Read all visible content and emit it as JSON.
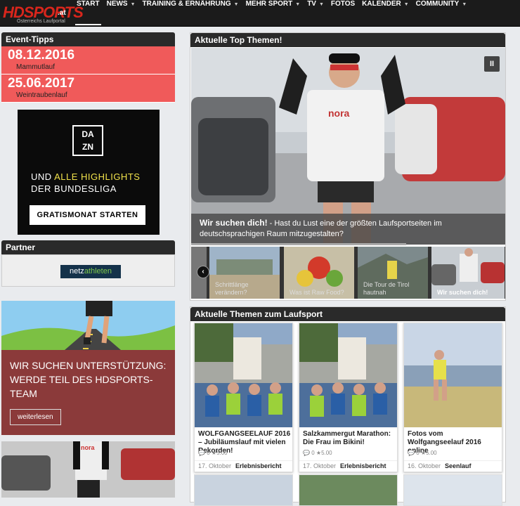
{
  "logo": {
    "text": "HDSPORTS",
    "suffix": ".at",
    "tagline": "Österreichs Laufportal"
  },
  "nav": {
    "items": [
      {
        "label": "START",
        "dropdown": false
      },
      {
        "label": "NEWS",
        "dropdown": true
      },
      {
        "label": "TRAINING & ERNÄHRUNG",
        "dropdown": true
      },
      {
        "label": "MEHR SPORT",
        "dropdown": true
      },
      {
        "label": "TV",
        "dropdown": true
      },
      {
        "label": "FOTOS",
        "dropdown": false
      },
      {
        "label": "KALENDER",
        "dropdown": true
      },
      {
        "label": "COMMUNITY",
        "dropdown": true
      }
    ]
  },
  "event_tipps": {
    "title": "Event-Tipps",
    "events": [
      {
        "date": "08.12.2016",
        "name": "Mammutlauf"
      },
      {
        "date": "25.06.2017",
        "name": "Weintraubenlauf"
      }
    ]
  },
  "ad": {
    "brand_top": "DA",
    "brand_bottom": "ZN",
    "line1_prefix": "UND ",
    "line1_highlight": "ALLE HIGHLIGHTS",
    "line2": "DER BUNDESLIGA",
    "button": "GRATISMONAT STARTEN"
  },
  "partner": {
    "title": "Partner",
    "logo_a": "netz",
    "logo_b": "athleten"
  },
  "support": {
    "title": "WIR SUCHEN UNTERSTÜTZUNG: WERDE TEIL DES HDSPORTS-TEAM",
    "button": "weiterlesen"
  },
  "top_themen": {
    "title": "Aktuelle Top Themen!",
    "pause_icon": "II",
    "caption_title": "Wir suchen dich!",
    "caption_text": " - Hast du Lust eine der größten Laufsportseiten im deutschsprachigen Raum mitzugestalten?",
    "slide_shirt": "nora",
    "thumbnails": [
      {
        "label": "Schrittlänge verändern?"
      },
      {
        "label": "Was ist Raw Food?"
      },
      {
        "label": "Die Tour de Tirol hautnah"
      },
      {
        "label": "Wir suchen dich!"
      }
    ],
    "arrow": "‹"
  },
  "laufsport": {
    "title": "Aktuelle Themen zum Laufsport",
    "cards": [
      {
        "title": "WOLFGANGSEELAUF 2016 – Jubiläumslauf mit vielen Rekorden!",
        "comments": "0",
        "rating": "5.00",
        "date": "17. Oktober",
        "category": "Erlebnisbericht"
      },
      {
        "title": "Salzkammergut Marathon: Die Frau im Bikini!",
        "comments": "0",
        "rating": "5.00",
        "date": "17. Oktober",
        "category": "Erlebnisbericht"
      },
      {
        "title": "Fotos vom Wolfgangseelauf 2016 online",
        "comments": "0",
        "rating": "5.00",
        "date": "16. Oktober",
        "category": "Seenlauf"
      }
    ]
  },
  "colors": {
    "accent_red": "#f05a5a",
    "support_red": "#8b3a3a",
    "nav_bg": "#1b1b1b",
    "dark_header": "#2a2a2a"
  }
}
